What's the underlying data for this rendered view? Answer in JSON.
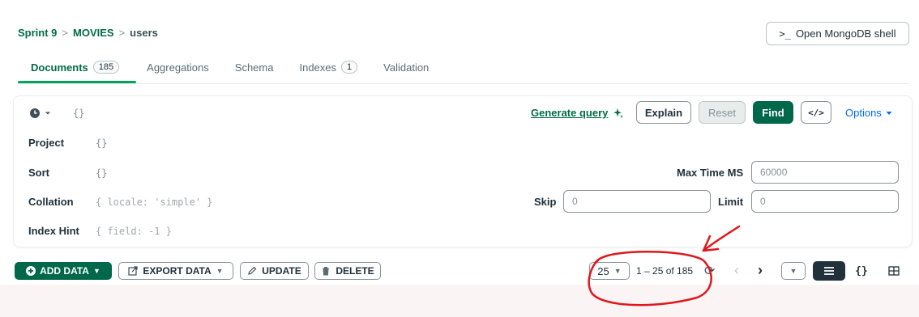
{
  "breadcrumb": {
    "cluster": "Sprint 9",
    "database": "MOVIES",
    "collection": "users",
    "sep": ">"
  },
  "shell_button": {
    "icon": ">_",
    "label": "Open MongoDB shell"
  },
  "tabs": [
    {
      "label": "Documents",
      "count": "185"
    },
    {
      "label": "Aggregations"
    },
    {
      "label": "Schema"
    },
    {
      "label": "Indexes",
      "count": "1"
    },
    {
      "label": "Validation"
    }
  ],
  "query": {
    "filter": "{}",
    "generate_query": "Generate query",
    "explain": "Explain",
    "reset": "Reset",
    "find": "Find",
    "code_icon": "</>",
    "options": "Options",
    "project_label": "Project",
    "project_value": "{}",
    "sort_label": "Sort",
    "sort_value": "{}",
    "collation_label": "Collation",
    "collation_placeholder": "{ locale: 'simple' }",
    "hint_label": "Index Hint",
    "hint_placeholder": "{ field: -1 }",
    "maxtime_label": "Max Time MS",
    "maxtime_placeholder": "60000",
    "skip_label": "Skip",
    "skip_placeholder": "0",
    "limit_label": "Limit",
    "limit_placeholder": "0"
  },
  "toolbar": {
    "add_data": "ADD DATA",
    "export_data": "EXPORT DATA",
    "update": "UPDATE",
    "delete": "DELETE",
    "page_size": "25",
    "range": "1 – 25 of 185"
  },
  "colors": {
    "accent": "#00684a",
    "link": "#016bf8",
    "annotation": "#e0171c"
  },
  "icons": [
    "clock-icon",
    "sparkle-icon",
    "plus-circle-icon",
    "export-icon",
    "pencil-icon",
    "trash-icon",
    "refresh-icon",
    "list-view-icon",
    "json-view-icon",
    "table-view-icon"
  ]
}
